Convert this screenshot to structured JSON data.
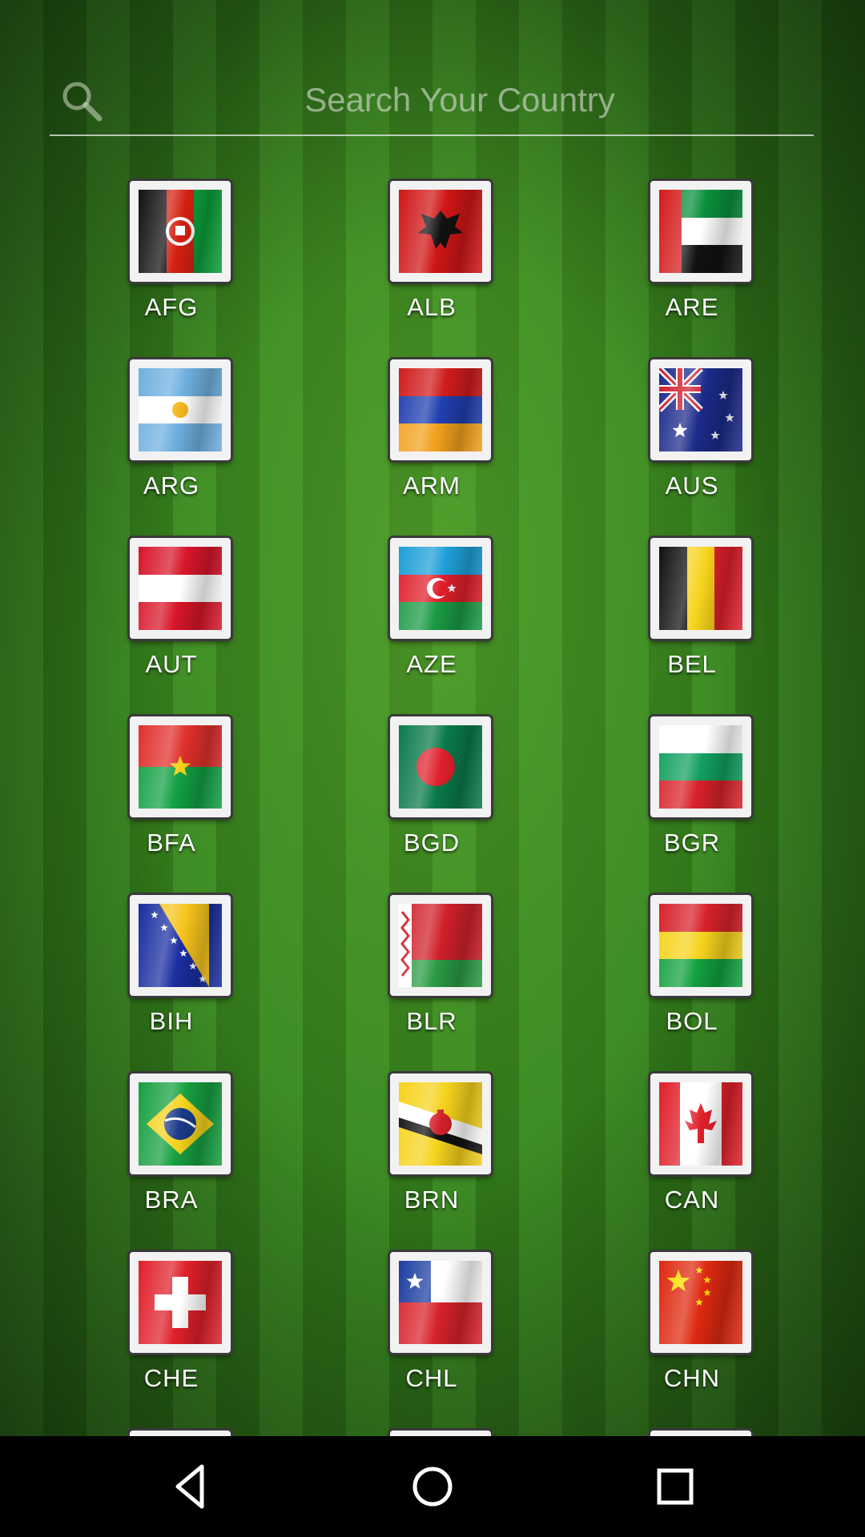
{
  "search": {
    "placeholder": "Search Your Country"
  },
  "countries": [
    {
      "code": "AFG",
      "flag": "afg"
    },
    {
      "code": "ALB",
      "flag": "alb"
    },
    {
      "code": "ARE",
      "flag": "are"
    },
    {
      "code": "ARG",
      "flag": "arg"
    },
    {
      "code": "ARM",
      "flag": "arm"
    },
    {
      "code": "AUS",
      "flag": "aus"
    },
    {
      "code": "AUT",
      "flag": "aut"
    },
    {
      "code": "AZE",
      "flag": "aze"
    },
    {
      "code": "BEL",
      "flag": "bel"
    },
    {
      "code": "BFA",
      "flag": "bfa"
    },
    {
      "code": "BGD",
      "flag": "bgd"
    },
    {
      "code": "BGR",
      "flag": "bgr"
    },
    {
      "code": "BIH",
      "flag": "bih"
    },
    {
      "code": "BLR",
      "flag": "blr"
    },
    {
      "code": "BOL",
      "flag": "bol"
    },
    {
      "code": "BRA",
      "flag": "bra"
    },
    {
      "code": "BRN",
      "flag": "brn"
    },
    {
      "code": "CAN",
      "flag": "can"
    },
    {
      "code": "CHE",
      "flag": "che"
    },
    {
      "code": "CHL",
      "flag": "chl"
    },
    {
      "code": "CHN",
      "flag": "chn"
    }
  ],
  "navbar": {
    "back": "back-icon",
    "home": "home-icon",
    "recents": "recents-icon"
  }
}
